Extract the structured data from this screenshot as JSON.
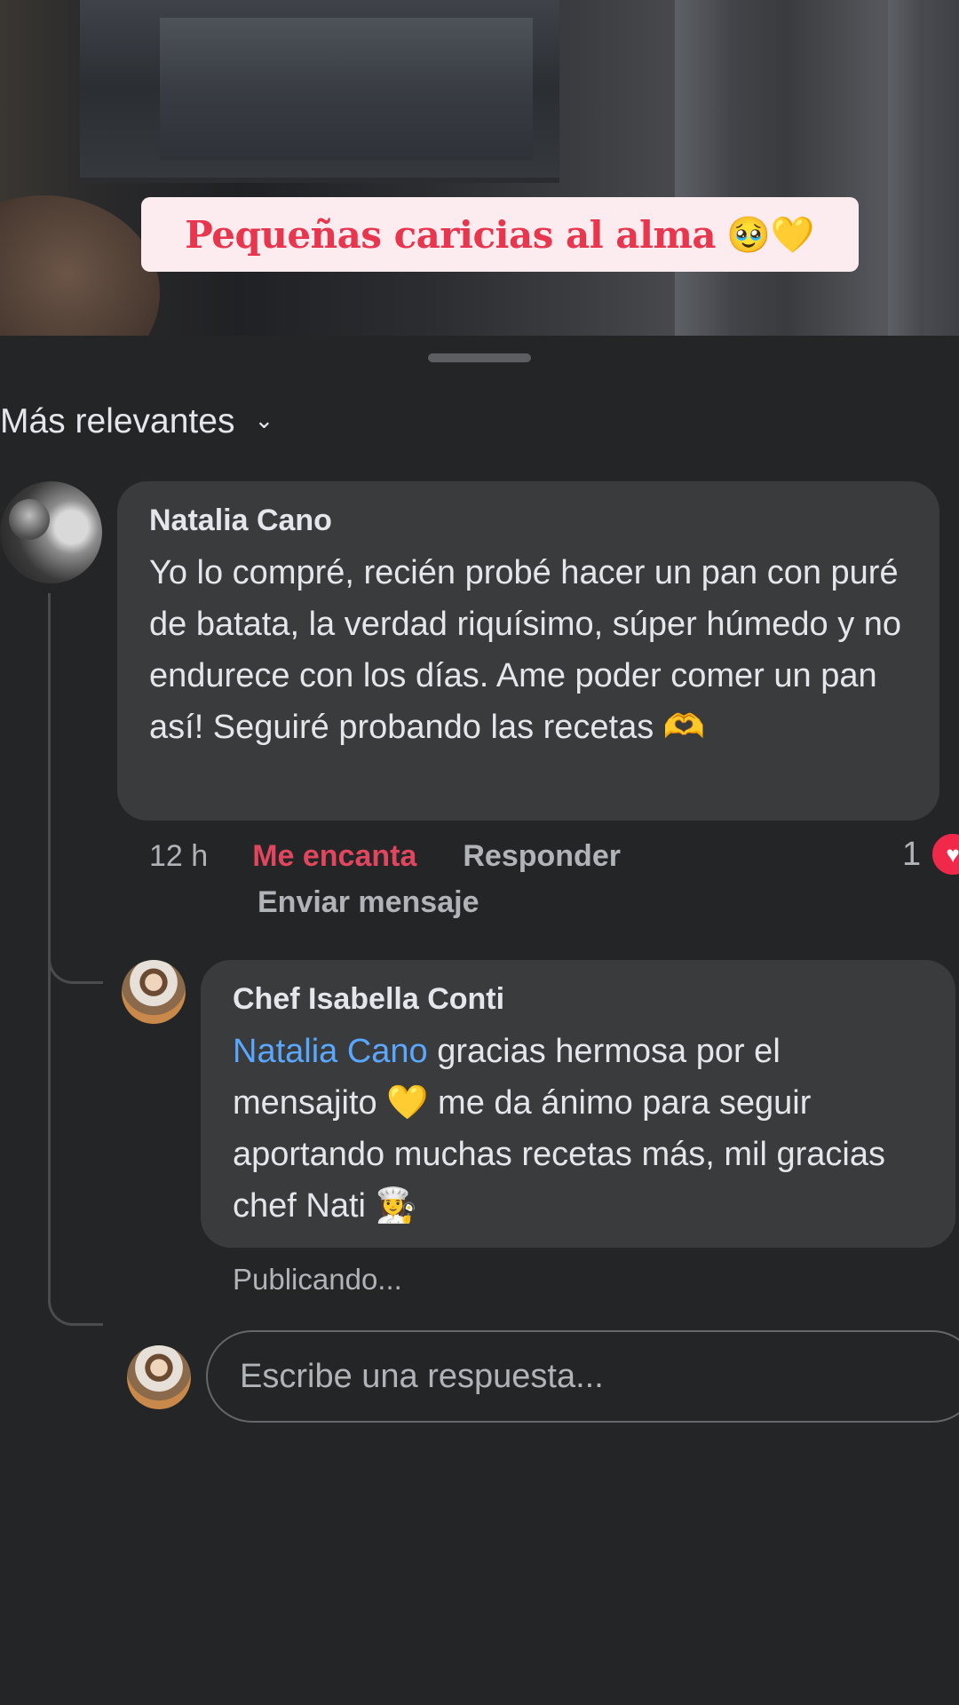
{
  "video": {
    "caption_text": "Pequeñas caricias al alma",
    "caption_emoji": "🥹💛"
  },
  "comments": {
    "sort_label": "Más relevantes",
    "main": {
      "author": "Natalia Cano",
      "text": "Yo lo compré, recién probé hacer un pan con puré de batata, la verdad riquísimo, súper húmedo y no endurece con los días. Ame poder comer un pan así! Seguiré probando las recetas 🫶",
      "time": "12 h",
      "love_label": "Me encanta",
      "reply_label": "Responder",
      "send_message_label": "Enviar mensaje",
      "reaction_count": "1",
      "reaction_icon": "heart-icon"
    },
    "reply": {
      "author": "Chef Isabella Conti",
      "mention": "Natalia Cano",
      "text": " gracias hermosa por el mensajito 💛 me da ánimo para seguir aportando muchas recetas más, mil gracias chef Nati 👩‍🍳",
      "status": "Publicando..."
    },
    "reply_input": {
      "placeholder": "Escribe una respuesta..."
    }
  },
  "colors": {
    "background": "#242526",
    "bubble": "#3a3b3c",
    "love": "#e0475e",
    "mention": "#5aa7ff",
    "caption_text": "#e8364f",
    "caption_bg": "#fdecef"
  }
}
